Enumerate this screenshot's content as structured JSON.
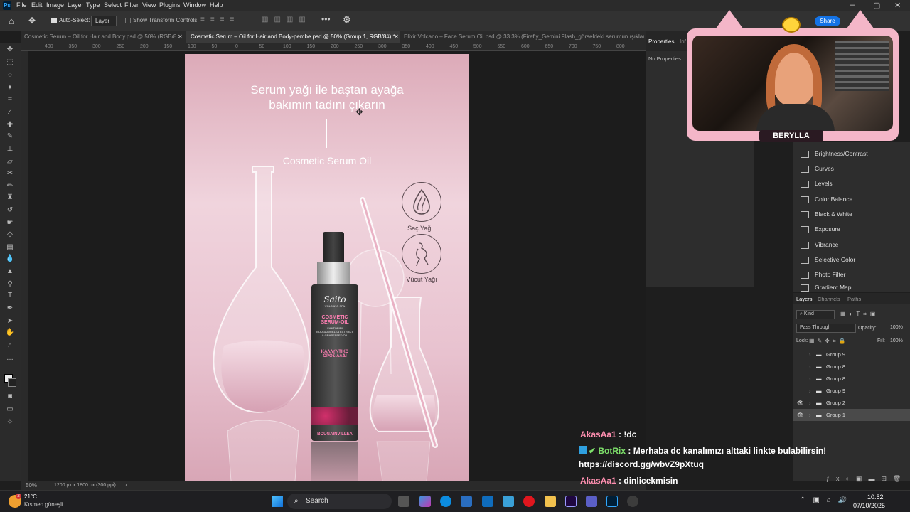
{
  "menubar": {
    "items": [
      "File",
      "Edit",
      "Image",
      "Layer",
      "Type",
      "Select",
      "Filter",
      "View",
      "Plugins",
      "Window",
      "Help"
    ]
  },
  "options": {
    "auto_select": "Auto-Select:",
    "layer_select": "Layer",
    "transform": "Show Transform Controls",
    "share": "Share"
  },
  "tabs": [
    {
      "label": "Cosmetic Serum – Oil for Hair and Body.psd @ 50% (RGB/8...",
      "active": false
    },
    {
      "label": "Cosmetic Serum – Oil for Hair and Body-pembe.psd @ 50% (Group 1, RGB/8#) *",
      "active": true
    },
    {
      "label": "Elixir Volcano – Face Serum Oil.psd @ 33.3% (Firefly_Gemini Flash_görseldeki serumun ışıklarını gö",
      "active": false
    }
  ],
  "ruler": [
    "400",
    "350",
    "300",
    "250",
    "200",
    "150",
    "100",
    "50",
    "0",
    "50",
    "100",
    "150",
    "200",
    "250",
    "300",
    "350",
    "400",
    "450",
    "500",
    "550",
    "600",
    "650",
    "700",
    "750",
    "800",
    "850",
    "900",
    "950",
    "1000",
    "1050",
    "1100",
    "1150",
    "1200",
    "1250",
    "1300",
    "1350",
    "1400",
    "1450",
    "1500",
    "1550",
    "1600"
  ],
  "canvas": {
    "headline_1": "Serum yağı ile baştan ayağa",
    "headline_2": "bakımın tadını çıkarın",
    "subtitle": "Cosmetic Serum Oil",
    "badge_1": "Saç Yağı",
    "badge_2": "Vücut Yağı",
    "bottle": {
      "brand": "Saito",
      "line": "VOLCANO SPA",
      "product_1": "COSMETIC",
      "product_2": "SERUM-OIL",
      "ingredients": "SANTORINI BOUGAINVILLEA EXTRACT & GRAPESEED OIL",
      "label_gr_1": "ΚΑΛΛΥΝΤΙΚΟ",
      "label_gr_2": "ΟΡΟΣ-ΛΑΔΙ",
      "scent": "BOUGAINVILLEA"
    }
  },
  "status": {
    "zoom": "50%",
    "size": "1200 px x 1800 px (300 ppi)"
  },
  "properties": {
    "tab_1": "Properties",
    "tab_2": "Inf",
    "empty": "No Properties"
  },
  "adjustments": [
    "Brightness/Contrast",
    "Curves",
    "Levels",
    "Color Balance",
    "Black & White",
    "Exposure",
    "Vibrance",
    "Selective Color",
    "Photo Filter",
    "Gradient Map"
  ],
  "layers_panel": {
    "tabs": [
      "Layers",
      "Channels",
      "Paths"
    ],
    "kind": "Kind",
    "blend": "Pass Through",
    "opacity_label": "Opacity:",
    "opacity": "100%",
    "lock_label": "Lock:",
    "fill_label": "Fill:",
    "fill": "100%",
    "rows": [
      {
        "name": "Group 9",
        "visible": false
      },
      {
        "name": "Group 8",
        "visible": false
      },
      {
        "name": "Group 8",
        "visible": false
      },
      {
        "name": "Group 9",
        "visible": false
      },
      {
        "name": "Group 2",
        "visible": true
      },
      {
        "name": "Group 1",
        "visible": true,
        "selected": true
      }
    ]
  },
  "webcam": {
    "name": "BERYLLA"
  },
  "chat": [
    {
      "user": "AkasAa1",
      "user_color": "#ff8fb0",
      "text": "!dc"
    },
    {
      "user": "BotRix",
      "user_color": "#7ee16b",
      "text": "Merhaba dc kanalımızı alttaki linkte bulabilirsin!"
    },
    {
      "user": "",
      "user_color": "#ffffff",
      "text": "https://discord.gg/wbvZ9pXtuq"
    },
    {
      "user": "AkasAa1",
      "user_color": "#ff8fb0",
      "text": "dinlicekmisin"
    }
  ],
  "taskbar": {
    "temp": "21°C",
    "weather": "Kısmen güneşli",
    "search": "Search",
    "time": "10:52",
    "date": "07/10/2025"
  }
}
